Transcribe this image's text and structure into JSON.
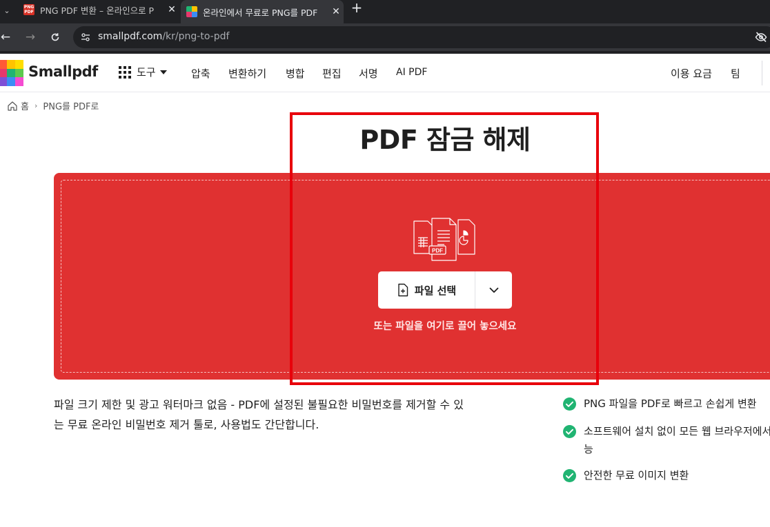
{
  "browser": {
    "tabs": [
      {
        "title": "PNG PDF 변환 – 온라인으로 P",
        "favicon": "png-pdf-icon",
        "active": false
      },
      {
        "title": "온라인에서 무료로 PNG를 PDF",
        "favicon": "smallpdf-icon",
        "active": true
      }
    ],
    "tab_menu_icon": "chevron-down-icon",
    "close_icon": "✕",
    "new_tab": "+",
    "url_host": "smallpdf.com",
    "url_path": "/kr/png-to-pdf"
  },
  "header": {
    "logo": "Smallpdf",
    "tools_label": "도구",
    "nav": [
      "압축",
      "변환하기",
      "병합",
      "편집",
      "서명",
      "AI PDF"
    ],
    "right_nav": [
      "이용 요금",
      "팀"
    ]
  },
  "breadcrumb": {
    "home": "홈",
    "separator": "›",
    "current": "PNG를 PDF로"
  },
  "hero": {
    "title": "PDF 잠금 해제",
    "choose_file_label": "파일 선택",
    "drop_hint": "또는 파일을 여기로 끌어 놓으세요"
  },
  "description": {
    "line1": "파일 크기 제한 및 광고 워터마크 없음 - PDF에 설정된 불필요한 비밀번호를 제거할 수 있",
    "line2": "는 무료 온라인 비밀번호 제거 툴로, 사용법도 간단합니다."
  },
  "features": [
    {
      "line1": "PNG 파일을 PDF로 빠르고 손쉽게 변환",
      "line2": ""
    },
    {
      "line1": "소프트웨어 설치 없이 모든 웹 브라우저에서",
      "line2": "능"
    },
    {
      "line1": "안전한 무료 이미지 변환",
      "line2": ""
    }
  ],
  "colors": {
    "dropzone": "#e03131",
    "annotation": "#e8000b",
    "check": "#20b472"
  }
}
